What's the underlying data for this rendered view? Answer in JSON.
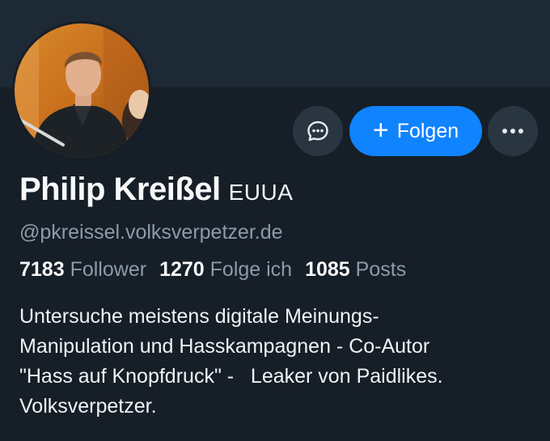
{
  "profile": {
    "display_name": "Philip Kreißel",
    "badge": "EUUA",
    "handle": "@pkreissel.volksverpetzer.de",
    "avatar_icon": "person-photo",
    "bio_lines": [
      "Untersuche meistens digitale Meinungs-",
      "Manipulation und Hasskampagnen - Co-Autor",
      "\"Hass auf Knopfdruck\" -   Leaker von Paidlikes.",
      "Volksverpetzer."
    ]
  },
  "stats": {
    "followers_count": "7183",
    "followers_label": "Follower",
    "following_count": "1270",
    "following_label": "Folge ich",
    "posts_count": "1085",
    "posts_label": "Posts"
  },
  "actions": {
    "message_icon": "chat-bubble-icon",
    "follow_icon": "plus",
    "follow_symbol": "+",
    "follow_label": "Folgen",
    "more_icon": "more-dots-icon"
  },
  "colors": {
    "background": "#161e27",
    "banner": "#1e2936",
    "accent": "#1083fe",
    "muted_text": "#8c9aab",
    "button_secondary": "#2a3542"
  }
}
